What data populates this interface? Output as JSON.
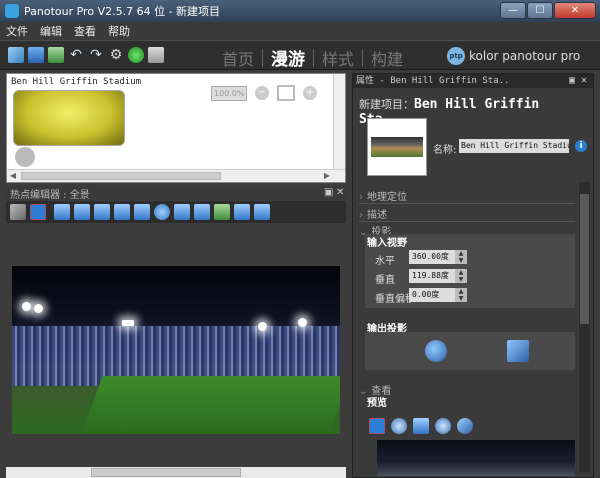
{
  "window": {
    "title": "Panotour Pro V2.5.7 64 位 - 新建项目",
    "app_icon": "pano",
    "btn_min": "—",
    "btn_max": "☐",
    "btn_close": "✕"
  },
  "menu": [
    "文件",
    "编辑",
    "查看",
    "帮助"
  ],
  "toolbar": {
    "icons": [
      "new-project-icon",
      "save-icon",
      "add-panorama-icon",
      "undo-icon",
      "redo-icon",
      "settings-icon",
      "build-icon",
      "export-icon"
    ],
    "nav": [
      {
        "label": "首页",
        "active": false
      },
      {
        "label": "漫游",
        "active": true
      },
      {
        "label": "样式",
        "active": false
      },
      {
        "label": "构建",
        "active": false
      }
    ],
    "brand_logo": "ptp",
    "brand": "kolor panotour pro"
  },
  "tour_panel": {
    "item_title": "Ben Hill Griffin Stadium",
    "zoom_placeholder": "100.0%",
    "zoom_out": "−",
    "zoom_in": "+"
  },
  "hotspot_editor": {
    "title": "热点编辑器 :  全景",
    "float_icon": "▣",
    "close_icon": "✕"
  },
  "properties": {
    "header": "属性 - Ben Hill Griffin Sta..",
    "project_prefix": "新建项目：",
    "project_name": "Ben Hill Griffin Sta...",
    "name_label": "名称:",
    "name_value": "Ben Hill Griffin Stadium",
    "info_icon": "i",
    "sections": {
      "geo": "地理定位",
      "desc": "描述",
      "projection": "投影",
      "view": "查看"
    },
    "input_view": {
      "title": "输入视野",
      "rows": [
        {
          "label": "水平",
          "value": "360.00度"
        },
        {
          "label": "垂直",
          "value": "119.88度"
        },
        {
          "label": "垂直偏移",
          "value": "0.00度"
        }
      ]
    },
    "output_projection": {
      "title": "输出投影"
    },
    "preview": {
      "title": "预览"
    }
  },
  "colors": {
    "accent": "#2b7fd3",
    "titlebar": "#3e5270",
    "panel_bg": "#3a3a3a"
  }
}
